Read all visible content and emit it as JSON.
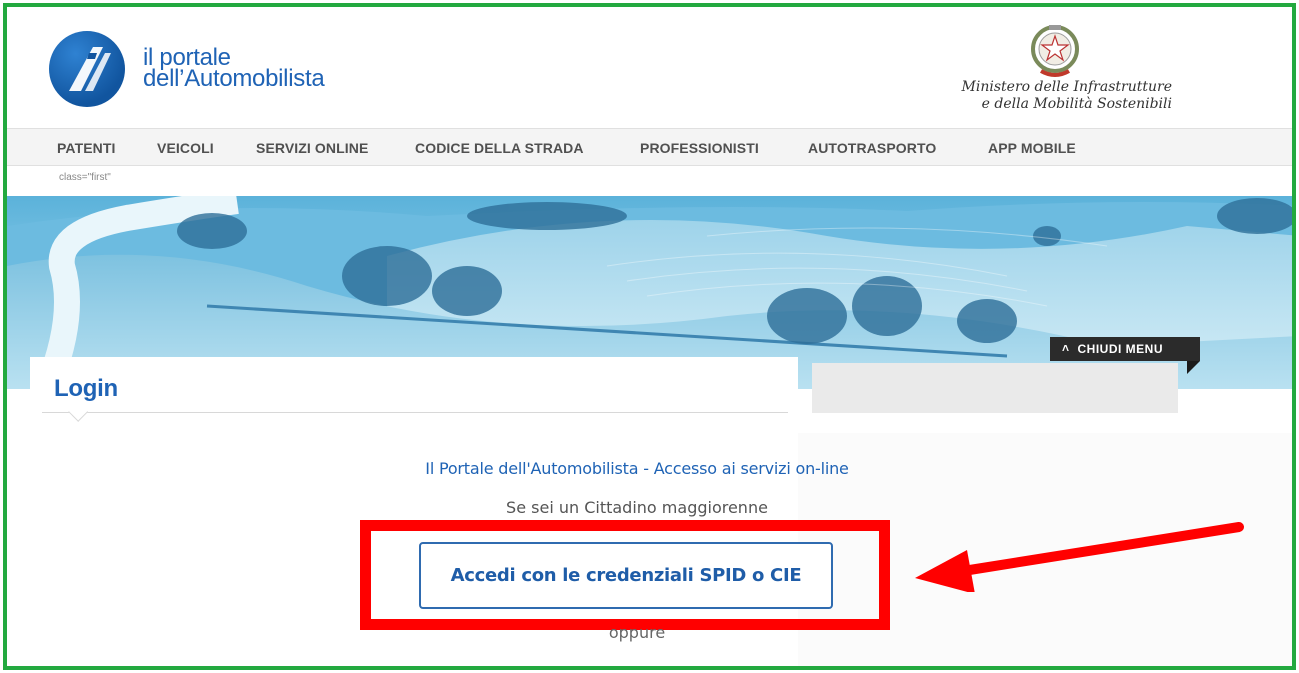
{
  "header": {
    "logo_line1": "il portale",
    "logo_line2": "dell’Automobilista",
    "ministry_line1": "Ministero delle Infrastrutture",
    "ministry_line2": "e della Mobilità Sostenibili"
  },
  "nav": {
    "items": [
      {
        "label": "PATENTI"
      },
      {
        "label": "VEICOLI"
      },
      {
        "label": "SERVIZI ONLINE"
      },
      {
        "label": "CODICE DELLA STRADA"
      },
      {
        "label": "PROFESSIONISTI"
      },
      {
        "label": "AUTOTRASPORTO"
      },
      {
        "label": "APP MOBILE"
      }
    ]
  },
  "subbar": {
    "text": "class=\"first\""
  },
  "banner": {
    "close_menu_label": "CHIUDI MENU"
  },
  "login": {
    "title": "Login",
    "access_title": "Il Portale dell'Automobilista - Accesso ai servizi on-line",
    "citizen_text": "Se sei un Cittadino maggiorenne",
    "spid_button_label": "Accedi con le credenziali SPID o CIE",
    "or_text": "oppure"
  },
  "colors": {
    "brand_blue": "#1f63b5",
    "frame_green": "#23a93f",
    "highlight_red": "#ff0000"
  }
}
